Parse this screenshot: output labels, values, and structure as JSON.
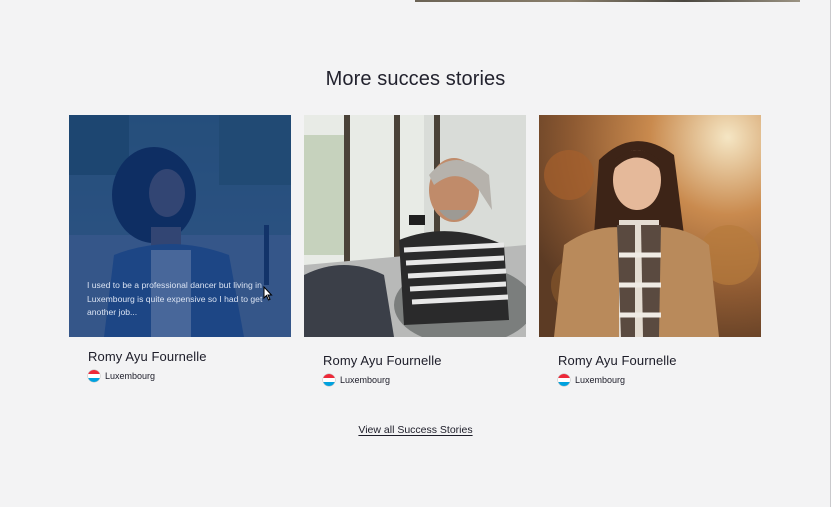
{
  "section": {
    "title": "More succes stories"
  },
  "stories": [
    {
      "name": "Romy Ayu Fournelle",
      "country": "Luxembourg",
      "quote": "I used to be a professional dancer but living in Luxembourg is quite expensive so I had to get another job..."
    },
    {
      "name": "Romy Ayu Fournelle",
      "country": "Luxembourg"
    },
    {
      "name": "Romy Ayu Fournelle",
      "country": "Luxembourg"
    }
  ],
  "view_all": {
    "label": "View all Success Stories"
  },
  "colors": {
    "background": "#f3f3f4",
    "overlay": "#0a3782",
    "flag_red": "#ed2939",
    "flag_white": "#ffffff",
    "flag_blue": "#00a1de"
  }
}
